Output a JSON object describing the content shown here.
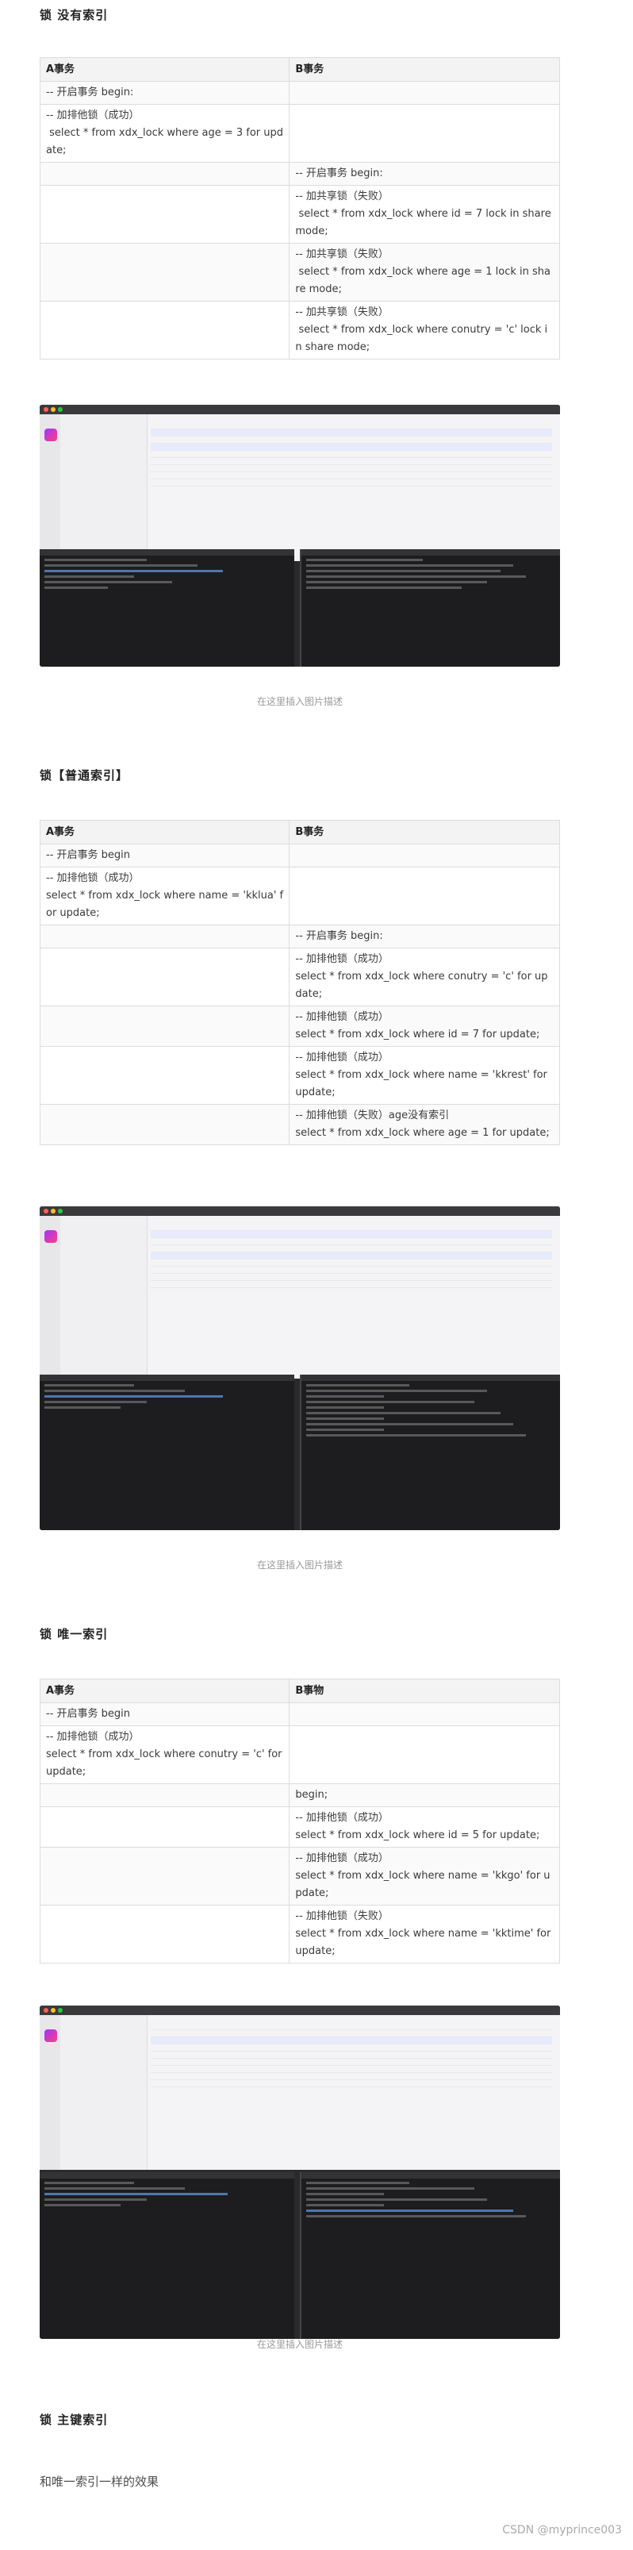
{
  "sections": [
    {
      "heading": "锁 没有索引",
      "table": {
        "headers": [
          "A事务",
          "B事务"
        ],
        "rows": [
          [
            "-- 开启事务 begin:",
            ""
          ],
          [
            "-- 加排他锁（成功）\n select * from xdx_lock where age = 3 for update;",
            ""
          ],
          [
            "",
            "-- 开启事务 begin:"
          ],
          [
            "",
            "-- 加共享锁（失败）\n select * from xdx_lock where id = 7 lock in share mode;"
          ],
          [
            "",
            "-- 加共享锁（失败）\n select * from xdx_lock where age = 1 lock in share mode;"
          ],
          [
            "",
            "-- 加共享锁（失败）\n select * from xdx_lock where conutry = 'c' lock in share mode;"
          ]
        ]
      },
      "caption": "在这里插入图片描述"
    },
    {
      "heading": "锁【普通索引】",
      "table": {
        "headers": [
          "A事务",
          "B事务"
        ],
        "rows": [
          [
            "-- 开启事务 begin",
            ""
          ],
          [
            "-- 加排他锁（成功）\nselect * from xdx_lock where name = 'kklua' for update;",
            ""
          ],
          [
            "",
            "-- 开启事务 begin:"
          ],
          [
            "",
            "-- 加排他锁（成功）\nselect * from xdx_lock where conutry = 'c' for update;"
          ],
          [
            "",
            "-- 加排他锁（成功）\nselect * from xdx_lock where id = 7 for update;"
          ],
          [
            "",
            "-- 加排他锁（成功）\nselect * from xdx_lock where name = 'kkrest' for update;"
          ],
          [
            "",
            "-- 加排他锁（失败）age没有索引\nselect * from xdx_lock where age = 1 for update;"
          ]
        ]
      },
      "caption": "在这里插入图片描述"
    },
    {
      "heading": "锁 唯一索引",
      "table": {
        "headers": [
          "A事务",
          "B事物"
        ],
        "rows": [
          [
            "-- 开启事务 begin",
            ""
          ],
          [
            "-- 加排他锁（成功）\nselect * from xdx_lock where conutry = 'c' for update;",
            ""
          ],
          [
            "",
            "begin;"
          ],
          [
            "",
            "-- 加排他锁（成功）\nselect * from xdx_lock where id = 5 for update;"
          ],
          [
            "",
            "-- 加排他锁（成功）\nselect * from xdx_lock where name = 'kkgo' for update;"
          ],
          [
            "",
            "-- 加排他锁（失败）\nselect * from xdx_lock where name = 'kktime' for update;"
          ]
        ]
      },
      "caption": "在这里插入图片描述"
    },
    {
      "heading": "锁 主键索引",
      "paragraph": "和唯一索引一样的效果"
    }
  ],
  "watermark": "CSDN @myprince003"
}
